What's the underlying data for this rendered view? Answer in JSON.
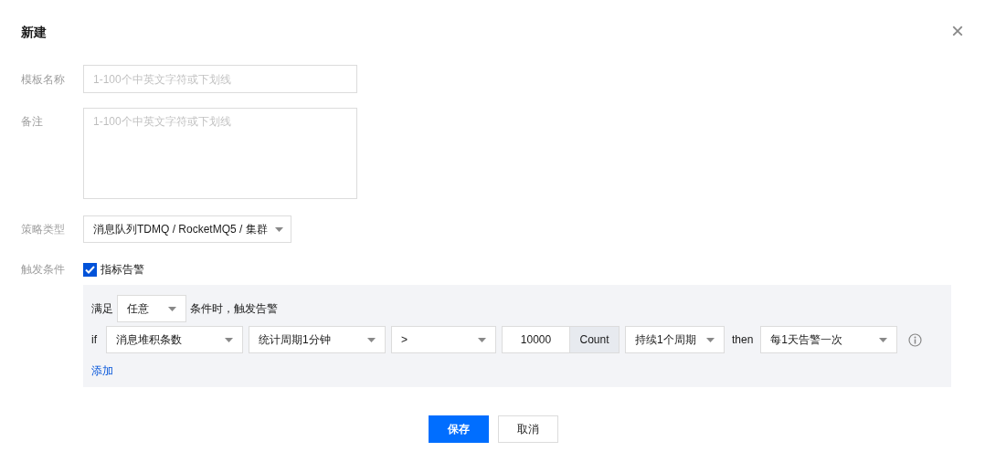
{
  "dialog": {
    "title": "新建",
    "close": "×"
  },
  "form": {
    "name": {
      "label": "模板名称",
      "placeholder": "1-100个中英文字符或下划线"
    },
    "remark": {
      "label": "备注",
      "placeholder": "1-100个中英文字符或下划线"
    },
    "policy_type": {
      "label": "策略类型",
      "value": "消息队列TDMQ / RocketMQ5 / 集群"
    },
    "trigger": {
      "label": "触发条件",
      "checkbox": {
        "label": "指标告警",
        "checked": true
      }
    }
  },
  "condition": {
    "prefix": "满足",
    "match": "任意",
    "suffix": "条件时，触发告警",
    "if": "if",
    "metric": "消息堆积条数",
    "period": "统计周期1分钟",
    "operator": ">",
    "threshold": "10000",
    "unit": "Count",
    "duration": "持续1个周期",
    "then": "then",
    "frequency": "每1天告警一次",
    "add": "添加"
  },
  "buttons": [
    {
      "label": "保存",
      "kind": "primary"
    },
    {
      "label": "取消",
      "kind": "default"
    }
  ]
}
